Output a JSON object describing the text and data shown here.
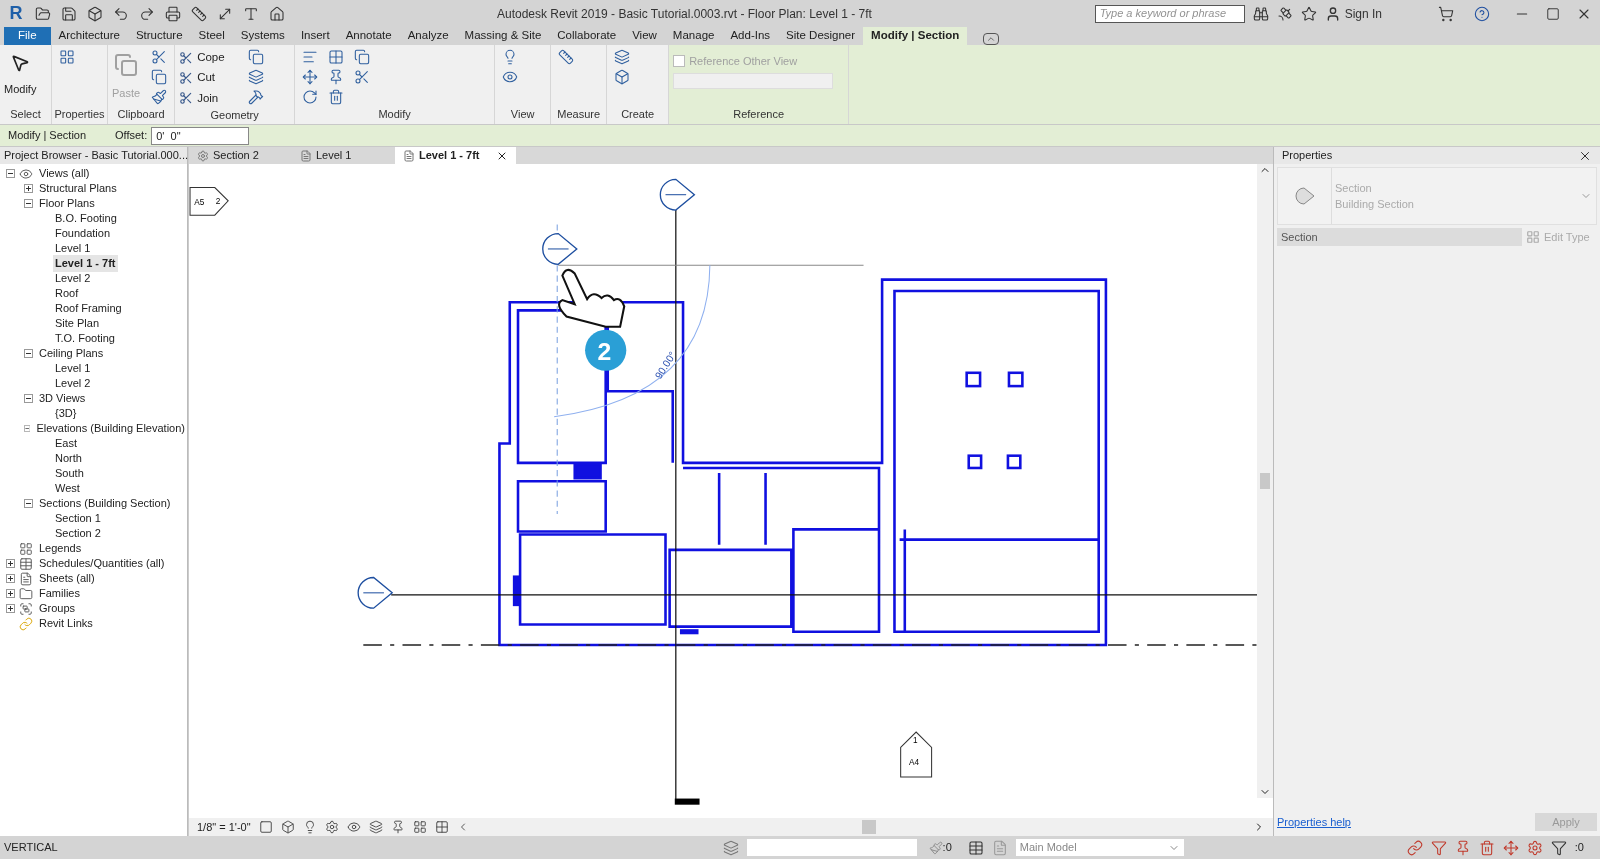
{
  "title_bar": {
    "logo": "R",
    "title": "Autodesk Revit 2019 - Basic Tutorial.0003.rvt - Floor Plan: Level 1 - 7ft",
    "search": {
      "placeholder": "Type a keyword or phrase"
    },
    "sign_in": "Sign In"
  },
  "ribbon_tabs": [
    {
      "label": "File",
      "kind": "file",
      "selected": false
    },
    {
      "label": "Architecture",
      "kind": "tab",
      "selected": false
    },
    {
      "label": "Structure",
      "kind": "tab",
      "selected": false
    },
    {
      "label": "Steel",
      "kind": "tab",
      "selected": false
    },
    {
      "label": "Systems",
      "kind": "tab",
      "selected": false
    },
    {
      "label": "Insert",
      "kind": "tab",
      "selected": false
    },
    {
      "label": "Annotate",
      "kind": "tab",
      "selected": false
    },
    {
      "label": "Analyze",
      "kind": "tab",
      "selected": false
    },
    {
      "label": "Massing & Site",
      "kind": "tab",
      "selected": false
    },
    {
      "label": "Collaborate",
      "kind": "tab",
      "selected": false
    },
    {
      "label": "View",
      "kind": "tab",
      "selected": false
    },
    {
      "label": "Manage",
      "kind": "tab",
      "selected": false
    },
    {
      "label": "Add-Ins",
      "kind": "tab",
      "selected": false
    },
    {
      "label": "Site Designer",
      "kind": "tab",
      "selected": false
    },
    {
      "label": "Modify | Section",
      "kind": "contextual",
      "selected": true
    }
  ],
  "ribbon_panels": [
    {
      "label": "Select",
      "contextual": false,
      "tools": [
        {
          "label": "Modify",
          "kind": "large",
          "disabled": false
        }
      ]
    },
    {
      "label": "Properties",
      "contextual": false
    },
    {
      "label": "Clipboard",
      "contextual": false,
      "tools": [
        {
          "label": "Paste",
          "kind": "large",
          "disabled": true
        }
      ]
    },
    {
      "label": "Geometry",
      "contextual": false,
      "tools": [
        {
          "label": "Cope",
          "kind": "small",
          "disabled": false
        },
        {
          "label": "Cut",
          "kind": "small",
          "disabled": false
        },
        {
          "label": "Join",
          "kind": "small",
          "disabled": false
        }
      ]
    },
    {
      "label": "Modify",
      "contextual": false
    },
    {
      "label": "View",
      "contextual": false
    },
    {
      "label": "Measure",
      "contextual": false
    },
    {
      "label": "Create",
      "contextual": false
    },
    {
      "label": "Reference",
      "contextual": true,
      "tools": [
        {
          "label": "Reference Other View",
          "kind": "checkbox",
          "disabled": true,
          "checked": false
        }
      ]
    }
  ],
  "options_bar": {
    "context": "Modify | Section",
    "offset_label": "Offset:",
    "offset_value": "0'  0\""
  },
  "project_browser": {
    "title": "Project Browser - Basic Tutorial.000...",
    "tree": [
      {
        "label": "Views (all)",
        "kind": "views",
        "expanded": true,
        "selected": false,
        "children": [
          {
            "label": "Structural Plans",
            "expanded": false,
            "selected": false
          },
          {
            "label": "Floor Plans",
            "expanded": true,
            "selected": false,
            "children": [
              {
                "label": "B.O. Footing",
                "selected": false
              },
              {
                "label": "Foundation",
                "selected": false
              },
              {
                "label": "Level 1",
                "selected": false
              },
              {
                "label": "Level 1 - 7ft",
                "selected": true
              },
              {
                "label": "Level 2",
                "selected": false
              },
              {
                "label": "Roof",
                "selected": false
              },
              {
                "label": "Roof Framing",
                "selected": false
              },
              {
                "label": "Site Plan",
                "selected": false
              },
              {
                "label": "T.O. Footing",
                "selected": false
              }
            ]
          },
          {
            "label": "Ceiling Plans",
            "expanded": true,
            "selected": false,
            "children": [
              {
                "label": "Level 1",
                "selected": false
              },
              {
                "label": "Level 2",
                "selected": false
              }
            ]
          },
          {
            "label": "3D Views",
            "expanded": true,
            "selected": false,
            "children": [
              {
                "label": "{3D}",
                "selected": false
              }
            ]
          },
          {
            "label": "Elevations (Building Elevation)",
            "expanded": true,
            "selected": false,
            "children": [
              {
                "label": "East",
                "selected": false
              },
              {
                "label": "North",
                "selected": false
              },
              {
                "label": "South",
                "selected": false
              },
              {
                "label": "West",
                "selected": false
              }
            ]
          },
          {
            "label": "Sections (Building Section)",
            "expanded": true,
            "selected": false,
            "children": [
              {
                "label": "Section 1",
                "selected": false
              },
              {
                "label": "Section 2",
                "selected": false
              }
            ]
          }
        ]
      },
      {
        "label": "Legends",
        "kind": "legends",
        "selected": false
      },
      {
        "label": "Schedules/Quantities (all)",
        "kind": "schedules",
        "expanded": false,
        "selected": false
      },
      {
        "label": "Sheets (all)",
        "kind": "sheets",
        "expanded": false,
        "selected": false
      },
      {
        "label": "Families",
        "kind": "families",
        "expanded": false,
        "selected": false
      },
      {
        "label": "Groups",
        "kind": "groups",
        "expanded": false,
        "selected": false
      },
      {
        "label": "Revit Links",
        "kind": "links",
        "selected": false
      }
    ]
  },
  "view_tabs": [
    {
      "label": "Section 2",
      "kind": "section",
      "selected": false
    },
    {
      "label": "Level 1",
      "kind": "plan",
      "selected": false
    },
    {
      "label": "Level 1 - 7ft",
      "kind": "plan",
      "selected": true
    }
  ],
  "canvas": {
    "elevation_tag": {
      "sheet": "A5",
      "number": "2"
    },
    "angle": "90.00°",
    "step_badge": "2",
    "callout": {
      "number": "1",
      "sheet": "A4"
    }
  },
  "view_control_bar": {
    "scale": "1/8\" = 1'-0\""
  },
  "properties": {
    "title": "Properties",
    "type_family": "Section",
    "type_name": "Building Section",
    "selector": "Section",
    "edit_type": "Edit Type",
    "help_link": "Properties help",
    "apply": "Apply"
  },
  "status_bar": {
    "message": "VERTICAL",
    "workset_count": ":0",
    "design_option": "Main Model",
    "filter_count": ":0"
  }
}
